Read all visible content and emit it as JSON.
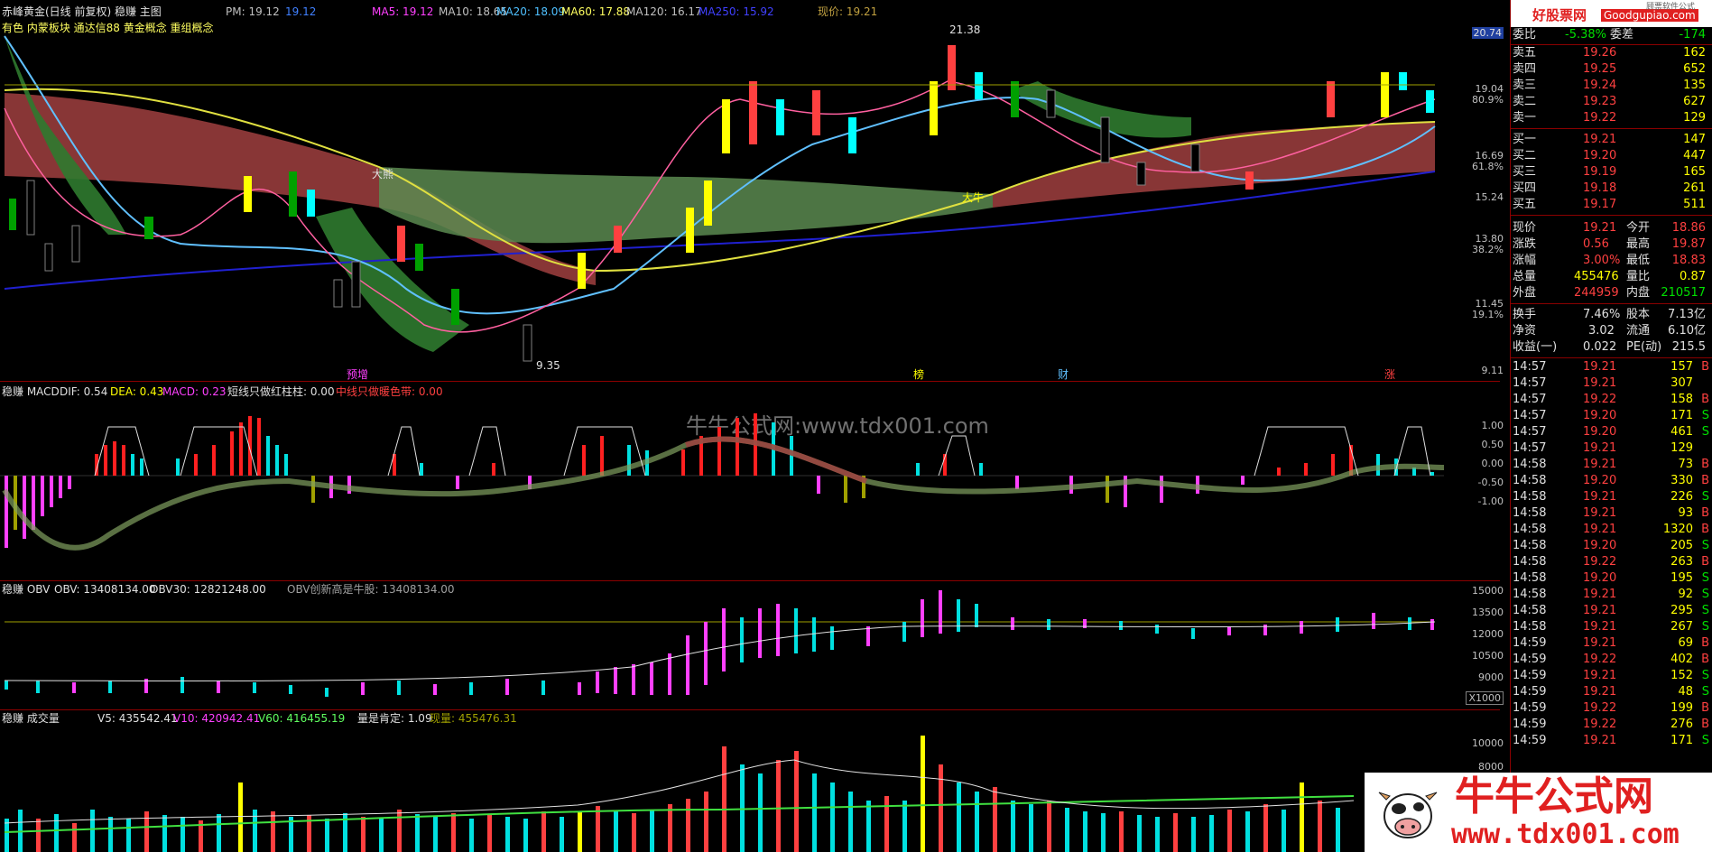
{
  "main": {
    "title": "赤峰黄金(日线 前复权) 稳赚 主图",
    "concepts": "有色 内蒙板块 通达信88 黄金概念 重组概念",
    "pm": "PM: 19.12",
    "pm2": "19.12",
    "ma5": "MA5: 19.12",
    "ma10": "MA10: 18.65",
    "ma20": "MA20: 18.09",
    "ma60": "MA60: 17.88",
    "ma120": "MA120: 16.17",
    "ma250": "MA250: 15.92",
    "price_now": "现价: 19.21",
    "high_label": "21.38",
    "low_label": "9.35",
    "bear_label": "大熊",
    "bull_label": "大牛",
    "event_labels": [
      "预增",
      "榜",
      "财",
      "涨"
    ],
    "axis_labels": [
      "20.74",
      "19.04",
      "80.9%",
      "16.69",
      "61.8%",
      "15.24",
      "13.80",
      "38.2%",
      "11.45",
      "19.1%",
      "9.11"
    ],
    "axis_right": [
      "",
      "",
      "",
      "",
      "",
      "",
      "",
      "",
      "",
      "",
      ""
    ]
  },
  "macd": {
    "title": "稳赚 MACD",
    "dif": "DIF: 0.54",
    "dea": "DEA: 0.43",
    "macd": "MACD: 0.23",
    "short": "短线只做红柱柱: 0.00",
    "mid": "中线只做暖色带: 0.00",
    "watermark": "牛牛公式网:www.tdx001.com",
    "axis": [
      "1.00",
      "0.50",
      "0.00",
      "-0.50",
      "-1.00"
    ]
  },
  "obv": {
    "title": "稳赚 OBV",
    "obv": "OBV: 13408134.00",
    "obv30": "OBV30: 12821248.00",
    "new_high": "OBV创新高是牛股: 13408134.00",
    "axis": [
      "15000",
      "13500",
      "12000",
      "10500",
      "9000"
    ],
    "unit": "X1000"
  },
  "vol": {
    "title": "稳赚 成交量",
    "v5": "V5: 435542.41",
    "v10": "V10: 420942.41",
    "v60": "V60: 416455.19",
    "ratio": "量是肯定: 1.09",
    "now": "现量: 455476.31",
    "axis": [
      "10000",
      "8000"
    ]
  },
  "quote": {
    "brand": "好股票网",
    "brand_url": "Goodgupiao.com",
    "brand_small": "顾票软件公式",
    "weibi_label": "委比",
    "weibi": "-5.38%",
    "weicha_label": "委差",
    "weicha": "-174",
    "sells": [
      {
        "label": "卖五",
        "price": "19.26",
        "vol": "162"
      },
      {
        "label": "卖四",
        "price": "19.25",
        "vol": "652"
      },
      {
        "label": "卖三",
        "price": "19.24",
        "vol": "135"
      },
      {
        "label": "卖二",
        "price": "19.23",
        "vol": "627"
      },
      {
        "label": "卖一",
        "price": "19.22",
        "vol": "129"
      }
    ],
    "buys": [
      {
        "label": "买一",
        "price": "19.21",
        "vol": "147"
      },
      {
        "label": "买二",
        "price": "19.20",
        "vol": "447"
      },
      {
        "label": "买三",
        "price": "19.19",
        "vol": "165"
      },
      {
        "label": "买四",
        "price": "19.18",
        "vol": "261"
      },
      {
        "label": "买五",
        "price": "19.17",
        "vol": "511"
      }
    ],
    "stats": [
      {
        "l1": "现价",
        "v1": "19.21",
        "l2": "今开",
        "v2": "18.86"
      },
      {
        "l1": "涨跌",
        "v1": "0.56",
        "l2": "最高",
        "v2": "19.87"
      },
      {
        "l1": "涨幅",
        "v1": "3.00%",
        "l2": "最低",
        "v2": "18.83"
      },
      {
        "l1": "总量",
        "v1": "455476",
        "l2": "量比",
        "v2": "0.87"
      },
      {
        "l1": "外盘",
        "v1": "244959",
        "l2": "内盘",
        "v2": "210517"
      }
    ],
    "stats2": [
      {
        "l1": "换手",
        "v1": "7.46%",
        "l2": "股本",
        "v2": "7.13亿"
      },
      {
        "l1": "净资",
        "v1": "3.02",
        "l2": "流通",
        "v2": "6.10亿"
      },
      {
        "l1": "收益(一)",
        "v1": "0.022",
        "l2": "PE(动)",
        "v2": "215.5"
      }
    ],
    "ticks": [
      {
        "t": "14:57",
        "p": "19.21",
        "v": "157",
        "d": "B"
      },
      {
        "t": "14:57",
        "p": "19.21",
        "v": "307",
        "d": ""
      },
      {
        "t": "14:57",
        "p": "19.22",
        "v": "158",
        "d": "B"
      },
      {
        "t": "14:57",
        "p": "19.20",
        "v": "171",
        "d": "S"
      },
      {
        "t": "14:57",
        "p": "19.20",
        "v": "461",
        "d": "S"
      },
      {
        "t": "14:57",
        "p": "19.21",
        "v": "129",
        "d": ""
      },
      {
        "t": "14:58",
        "p": "19.21",
        "v": "73",
        "d": "B"
      },
      {
        "t": "14:58",
        "p": "19.20",
        "v": "330",
        "d": "B"
      },
      {
        "t": "14:58",
        "p": "19.21",
        "v": "226",
        "d": "S"
      },
      {
        "t": "14:58",
        "p": "19.21",
        "v": "93",
        "d": "B"
      },
      {
        "t": "14:58",
        "p": "19.21",
        "v": "1320",
        "d": "B"
      },
      {
        "t": "14:58",
        "p": "19.20",
        "v": "205",
        "d": "S"
      },
      {
        "t": "14:58",
        "p": "19.22",
        "v": "263",
        "d": "B"
      },
      {
        "t": "14:58",
        "p": "19.20",
        "v": "195",
        "d": "S"
      },
      {
        "t": "14:58",
        "p": "19.21",
        "v": "92",
        "d": "S"
      },
      {
        "t": "14:58",
        "p": "19.21",
        "v": "295",
        "d": "S"
      },
      {
        "t": "14:58",
        "p": "19.21",
        "v": "267",
        "d": "S"
      },
      {
        "t": "14:59",
        "p": "19.21",
        "v": "69",
        "d": "B"
      },
      {
        "t": "14:59",
        "p": "19.22",
        "v": "402",
        "d": "B"
      },
      {
        "t": "14:59",
        "p": "19.21",
        "v": "152",
        "d": "S"
      },
      {
        "t": "14:59",
        "p": "19.21",
        "v": "48",
        "d": "S"
      },
      {
        "t": "14:59",
        "p": "19.22",
        "v": "199",
        "d": "B"
      },
      {
        "t": "14:59",
        "p": "19.22",
        "v": "276",
        "d": "B"
      },
      {
        "t": "14:59",
        "p": "19.21",
        "v": "171",
        "d": "S"
      }
    ]
  },
  "watermark": {
    "brand": "牛牛公式网",
    "url": "www.tdx001.com"
  },
  "colors": {
    "up": "#ff4040",
    "down": "#00ffff",
    "bull_band": "#a04040",
    "bear_band": "#408040",
    "axis_line": "#8b0000"
  }
}
